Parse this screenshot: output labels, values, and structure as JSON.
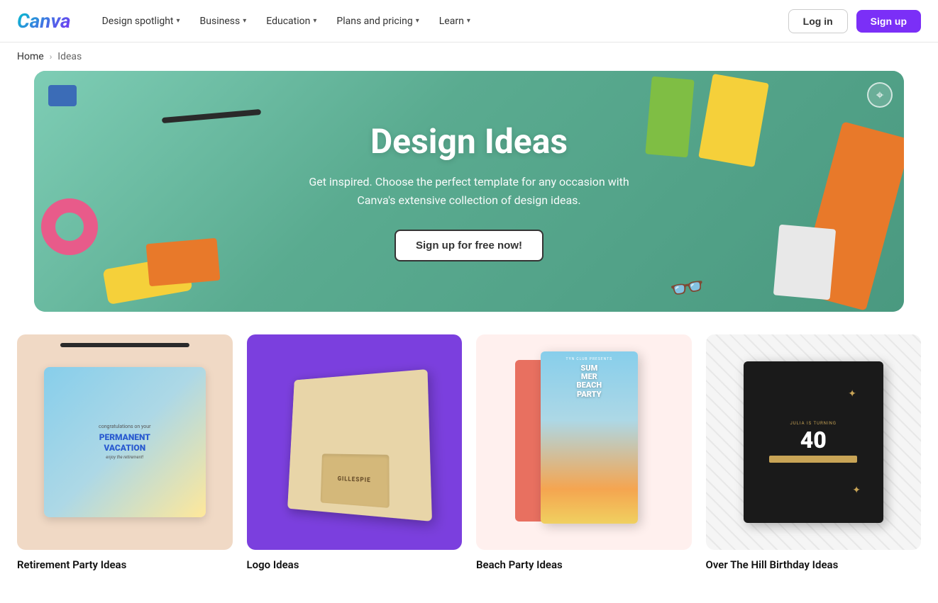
{
  "nav": {
    "logo": "Canva",
    "items": [
      {
        "label": "Design spotlight",
        "has_dropdown": true
      },
      {
        "label": "Business",
        "has_dropdown": true
      },
      {
        "label": "Education",
        "has_dropdown": true
      },
      {
        "label": "Plans and pricing",
        "has_dropdown": true
      },
      {
        "label": "Learn",
        "has_dropdown": true
      }
    ],
    "login_label": "Log in",
    "signup_label": "Sign up"
  },
  "breadcrumb": {
    "home": "Home",
    "separator": "›",
    "current": "Ideas"
  },
  "hero": {
    "title": "Design Ideas",
    "subtitle": "Get inspired. Choose the perfect template for any occasion with Canva's extensive collection of design ideas.",
    "cta_label": "Sign up for free now!"
  },
  "cards": [
    {
      "label": "Retirement Party Ideas",
      "type": "retirement",
      "inner": {
        "congrats": "congratulations on your",
        "title": "PERMANENT VACATION",
        "sub": "enjoy the retirement!"
      }
    },
    {
      "label": "Logo Ideas",
      "type": "logo",
      "inner": {
        "text": "GILLESPIE"
      }
    },
    {
      "label": "Beach Party Ideas",
      "type": "beach",
      "inner": {
        "header": "TYN CLUB PRESENTS",
        "title": "SUM MER BEACH PARTY"
      }
    },
    {
      "label": "Over The Hill Birthday Ideas",
      "type": "birthday",
      "inner": {
        "top": "JULIA IS TURNING",
        "number": "40"
      }
    }
  ]
}
